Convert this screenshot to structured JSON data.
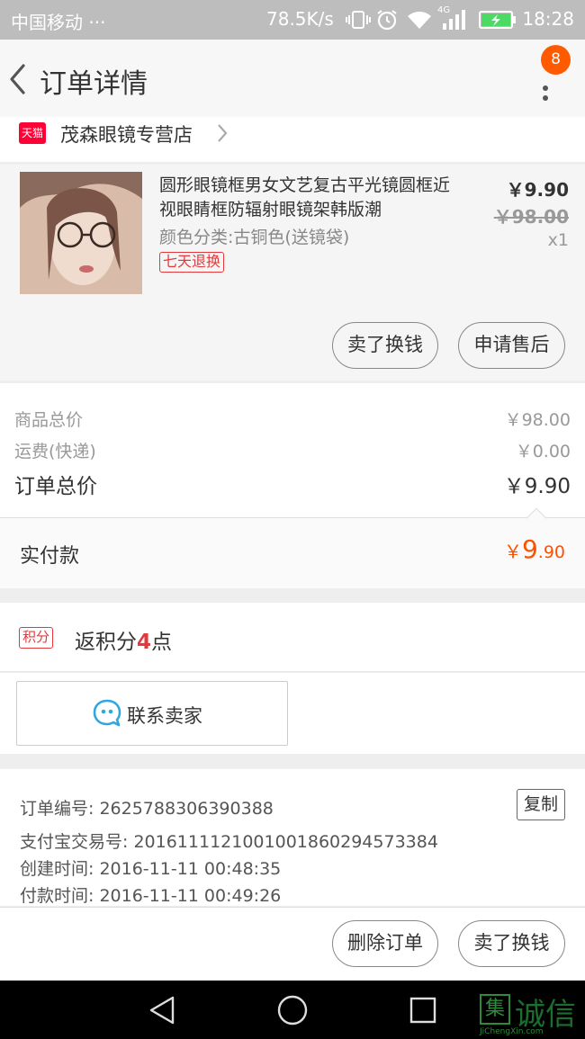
{
  "status_bar": {
    "carrier": "中国移动 ···",
    "net_speed": "78.5K/s",
    "network": "4G",
    "time": "18:28"
  },
  "nav": {
    "title": "订单详情",
    "badge_count": "8"
  },
  "shop": {
    "tmall_label": "天猫",
    "name": "茂森眼镜专营店"
  },
  "product": {
    "title": "圆形眼镜框男女文艺复古平光镜圆框近视眼睛框防辐射眼镜架韩版潮",
    "sku": "颜色分类:古铜色(送镜袋)",
    "tag": "七天退换",
    "price": "￥9.90",
    "original_price": "￥98.00",
    "quantity": "x1",
    "sell_button": "卖了换钱",
    "aftersale_button": "申请售后"
  },
  "summary": {
    "goods_total_label": "商品总价",
    "goods_total_value": "￥98.00",
    "shipping_label": "运费(快递)",
    "shipping_value": "￥0.00",
    "order_total_label": "订单总价",
    "order_total_value": "￥9.90"
  },
  "paid": {
    "label": "实付款",
    "currency": "￥",
    "integer": "9",
    "decimal": ".90"
  },
  "points": {
    "tag": "积分",
    "text_before": "返积分",
    "value": "4",
    "text_after": "点"
  },
  "contact": {
    "label": "联系卖家"
  },
  "order_info": {
    "order_no_label": "订单编号:",
    "order_no": "2625788306390388",
    "alipay_label": "支付宝交易号:",
    "alipay_no": "2016111121001001860294573384",
    "created_label": "创建时间:",
    "created_time": "2016-11-11 00:48:35",
    "paid_label": "付款时间:",
    "paid_time": "2016-11-11 00:49:26",
    "copy_button": "复制"
  },
  "actions": {
    "delete_button": "删除订单",
    "sell_button": "卖了换钱"
  },
  "watermark": {
    "box_char": "集",
    "text": "诚信",
    "sub": "JiChengXin.com"
  },
  "colors": {
    "accent": "#ff5000",
    "tmall_red": "#ff0036",
    "tag_red": "#e4393c",
    "status_bar": "#bdbdbd"
  }
}
